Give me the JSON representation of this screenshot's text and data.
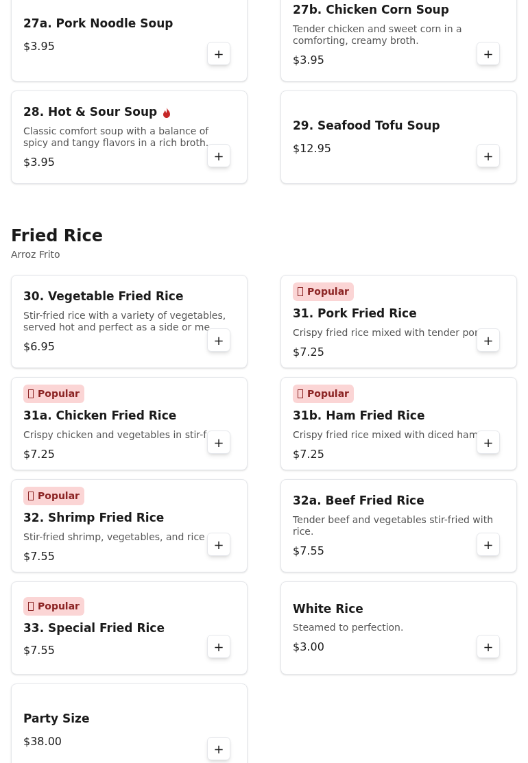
{
  "sections": [
    {
      "items": [
        {
          "name": "27a. Pork Noodle Soup",
          "price": "$3.95",
          "add": "+",
          "popular": false,
          "spicy": false
        },
        {
          "name": "27b. Chicken Corn Soup",
          "description": "Tender chicken and sweet corn in a comforting, creamy broth.",
          "price": "$3.95",
          "add": "+",
          "popular": false,
          "spicy": false
        },
        {
          "name": "28. Hot & Sour Soup",
          "description": "Classic comfort soup with a balance of spicy and tangy flavors in a rich broth.",
          "price": "$3.95",
          "add": "+",
          "popular": false,
          "spicy": true
        },
        {
          "name": "29. Seafood Tofu Soup",
          "price": "$12.95",
          "add": "+",
          "popular": false,
          "spicy": false
        }
      ]
    },
    {
      "title": "Fried Rice",
      "subtitle": "Arroz Frito",
      "items": [
        {
          "name": "30. Vegetable Fried Rice",
          "description": "Stir-fried rice with a variety of vegetables, served hot and perfect as a side or me",
          "price": "$6.95",
          "add": "+",
          "popular": false,
          "spicy": false
        },
        {
          "name": "31. Pork Fried Rice",
          "description": "Crispy fried rice mixed with tender por",
          "price": "$7.25",
          "add": "+",
          "popular": true,
          "badge": "Popular",
          "spicy": false
        },
        {
          "name": "31a. Chicken Fried Rice",
          "description": "Crispy chicken and vegetables in stir-f",
          "price": "$7.25",
          "add": "+",
          "popular": true,
          "badge": "Popular",
          "spicy": false
        },
        {
          "name": "31b. Ham Fried Rice",
          "description": "Crispy fried rice mixed with diced ham",
          "price": "$7.25",
          "add": "+",
          "popular": true,
          "badge": "Popular",
          "spicy": false
        },
        {
          "name": "32. Shrimp Fried Rice",
          "description": "Stir-fried shrimp, vegetables, and rice",
          "price": "$7.55",
          "add": "+",
          "popular": true,
          "badge": "Popular",
          "spicy": false
        },
        {
          "name": "32a. Beef Fried Rice",
          "description": "Tender beef and vegetables stir-fried with rice.",
          "price": "$7.55",
          "add": "+",
          "popular": false,
          "spicy": false
        },
        {
          "name": "33. Special Fried Rice",
          "price": "$7.55",
          "add": "+",
          "popular": true,
          "badge": "Popular",
          "spicy": false
        },
        {
          "name": "White Rice",
          "description": "Steamed to perfection.",
          "price": "$3.00",
          "add": "+",
          "popular": false,
          "spicy": false
        },
        {
          "name": "Party Size",
          "price": "$38.00",
          "add": "+",
          "popular": false,
          "spicy": false
        }
      ]
    }
  ]
}
